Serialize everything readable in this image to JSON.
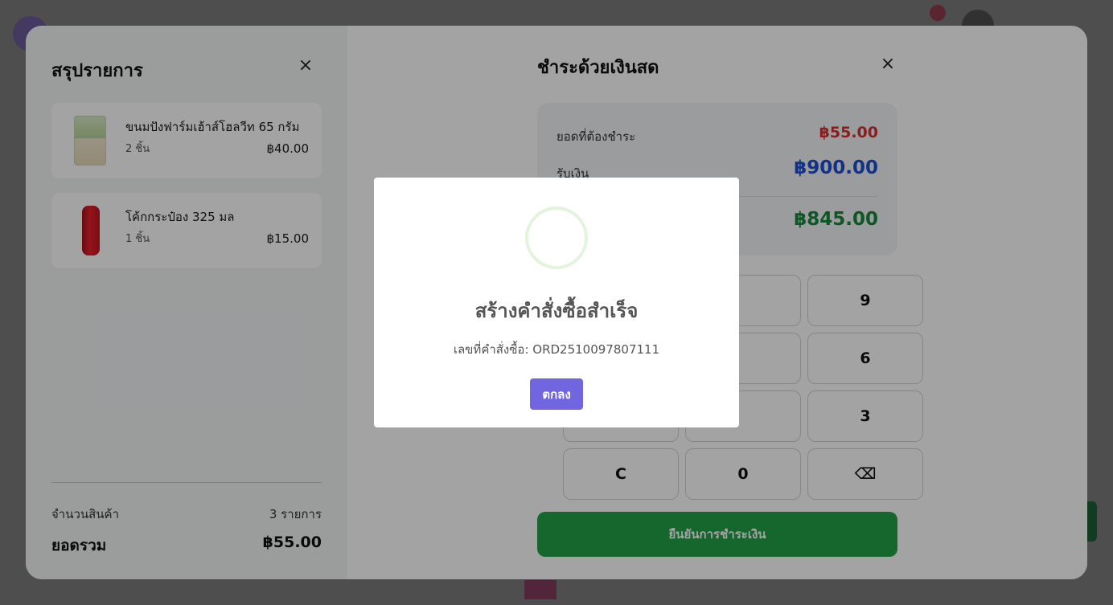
{
  "summary": {
    "title": "สรุปรายการ",
    "close_icon": "×",
    "items": [
      {
        "name": "ขนมปังฟาร์มเฮ้าส์โฮลวีท 65 กรัม",
        "qty": "2 ชิ้น",
        "price": "฿40.00",
        "image": "bread-package-image"
      },
      {
        "name": "โค้กกระป๋อง 325 มล",
        "qty": "1 ชิ้น",
        "price": "฿15.00",
        "image": "coke-can-image"
      }
    ],
    "count_label": "จำนวนสินค้า",
    "count_value": "3 รายการ",
    "total_label": "ยอดรวม",
    "total_value": "฿55.00"
  },
  "payment": {
    "title": "ชำระด้วยเงินสด",
    "close_icon": "×",
    "due_label": "ยอดที่ต้องชำระ",
    "due_value": "฿55.00",
    "received_label": "รับเงิน",
    "received_value": "฿900.00",
    "change_value": "฿845.00",
    "keys": {
      "k9": "9",
      "k6": "6",
      "k3": "3",
      "clear": "C",
      "zero": "0",
      "backspace": "⌫"
    },
    "confirm_label": "ยืนยันการชำระเงิน",
    "colors": {
      "due": "#d33131",
      "received": "#1d4fd8",
      "change": "#16883b",
      "confirm": "#22a147"
    }
  },
  "dialog": {
    "title": "สร้างคำสั่งซื้อสำเร็จ",
    "order_text": "เลขที่คำสั่งซื้อ: ORD2510097807111",
    "ok_label": "ตกลง",
    "ok_color": "#7166e0",
    "icon": "success-ring-icon"
  }
}
